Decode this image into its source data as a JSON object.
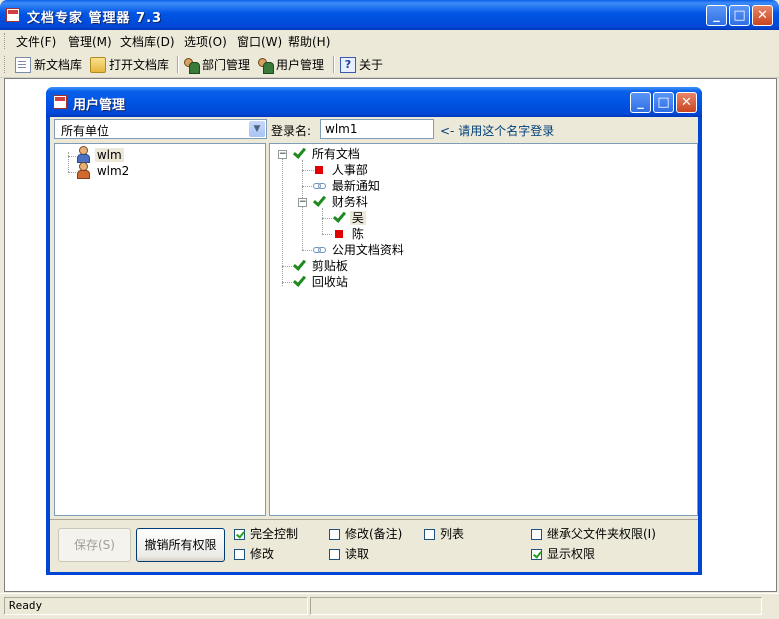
{
  "app": {
    "title": "文档专家 管理器 7.3",
    "menu": [
      "文件(F)",
      "管理(M)",
      "文档库(D)",
      "选项(O)",
      "窗口(W)",
      "帮助(H)"
    ],
    "toolbar": {
      "new_library": "新文档库",
      "open_library": "打开文档库",
      "dept_manage": "部门管理",
      "user_manage": "用户管理",
      "about": "关于"
    },
    "status": "Ready"
  },
  "dialog": {
    "title": "用户管理",
    "unit_select": "所有单位",
    "login_label": "登录名:",
    "login_value": "wlm1",
    "login_hint": "<- 请用这个名字登录",
    "users": [
      "wlm",
      "wlm2"
    ],
    "tree": {
      "root": "所有文档",
      "renshi": "人事部",
      "notice": "最新通知",
      "caiwu": "财务科",
      "wu": "吴",
      "chen": "陈",
      "public_docs": "公用文档资料",
      "clipboard": "剪贴板",
      "recycle": "回收站"
    },
    "buttons": {
      "save": "保存(S)",
      "revoke": "撤销所有权限"
    },
    "checkboxes": {
      "full_control": {
        "label": "完全控制",
        "checked": true
      },
      "modify": {
        "label": "修改",
        "checked": false
      },
      "modify_note": {
        "label": "修改(备注)",
        "checked": false
      },
      "read": {
        "label": "读取",
        "checked": false
      },
      "list": {
        "label": "列表",
        "checked": false
      },
      "inherit": {
        "label": "继承父文件夹权限(I)",
        "checked": false
      },
      "show_perm": {
        "label": "显示权限",
        "checked": true
      }
    }
  }
}
